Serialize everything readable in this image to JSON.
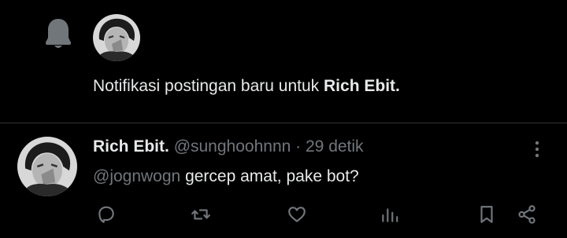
{
  "notification": {
    "text_prefix": "Notifikasi postingan baru untuk ",
    "user_name": "Rich Ebit."
  },
  "tweet": {
    "name": "Rich Ebit.",
    "handle": "@sunghoohnnn",
    "separator": "·",
    "time": "29 detik",
    "mention": "@jognwogn",
    "text": " gercep amat, pake bot?"
  },
  "icons": {
    "notification": "bell-icon",
    "more": "more-vertical-icon",
    "reply": "reply-icon",
    "retweet": "retweet-icon",
    "like": "heart-icon",
    "views": "views-icon",
    "bookmark": "bookmark-icon",
    "share": "share-icon"
  },
  "colors": {
    "background": "#000000",
    "text": "#e7e9ea",
    "muted": "#71767b",
    "divider": "#2f3336"
  }
}
